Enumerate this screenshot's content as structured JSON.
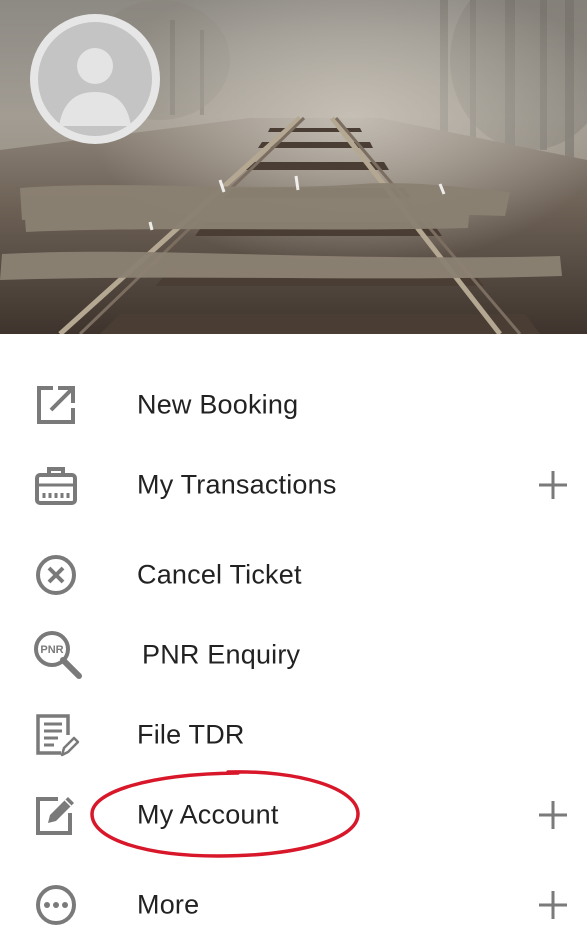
{
  "colors": {
    "icon_gray": "#7a7a7a",
    "text": "#222222",
    "annotation_red": "#d8182a",
    "header_fog": "#8a8478"
  },
  "header": {
    "avatar_icon": "person-silhouette-icon"
  },
  "menu": {
    "items": [
      {
        "label": "New Booking",
        "icon": "open-in-new-icon",
        "expandable": false
      },
      {
        "label": "My Transactions",
        "icon": "briefcase-icon",
        "expandable": true
      },
      {
        "label": "Cancel Ticket",
        "icon": "cancel-circle-icon",
        "expandable": false
      },
      {
        "label": "PNR Enquiry",
        "icon": "pnr-search-icon",
        "expandable": false
      },
      {
        "label": "File TDR",
        "icon": "document-edit-icon",
        "expandable": false
      },
      {
        "label": "My Account",
        "icon": "edit-square-icon",
        "expandable": true
      },
      {
        "label": "More",
        "icon": "more-circle-icon",
        "expandable": true
      }
    ],
    "pnr_icon_text": "PNR"
  }
}
